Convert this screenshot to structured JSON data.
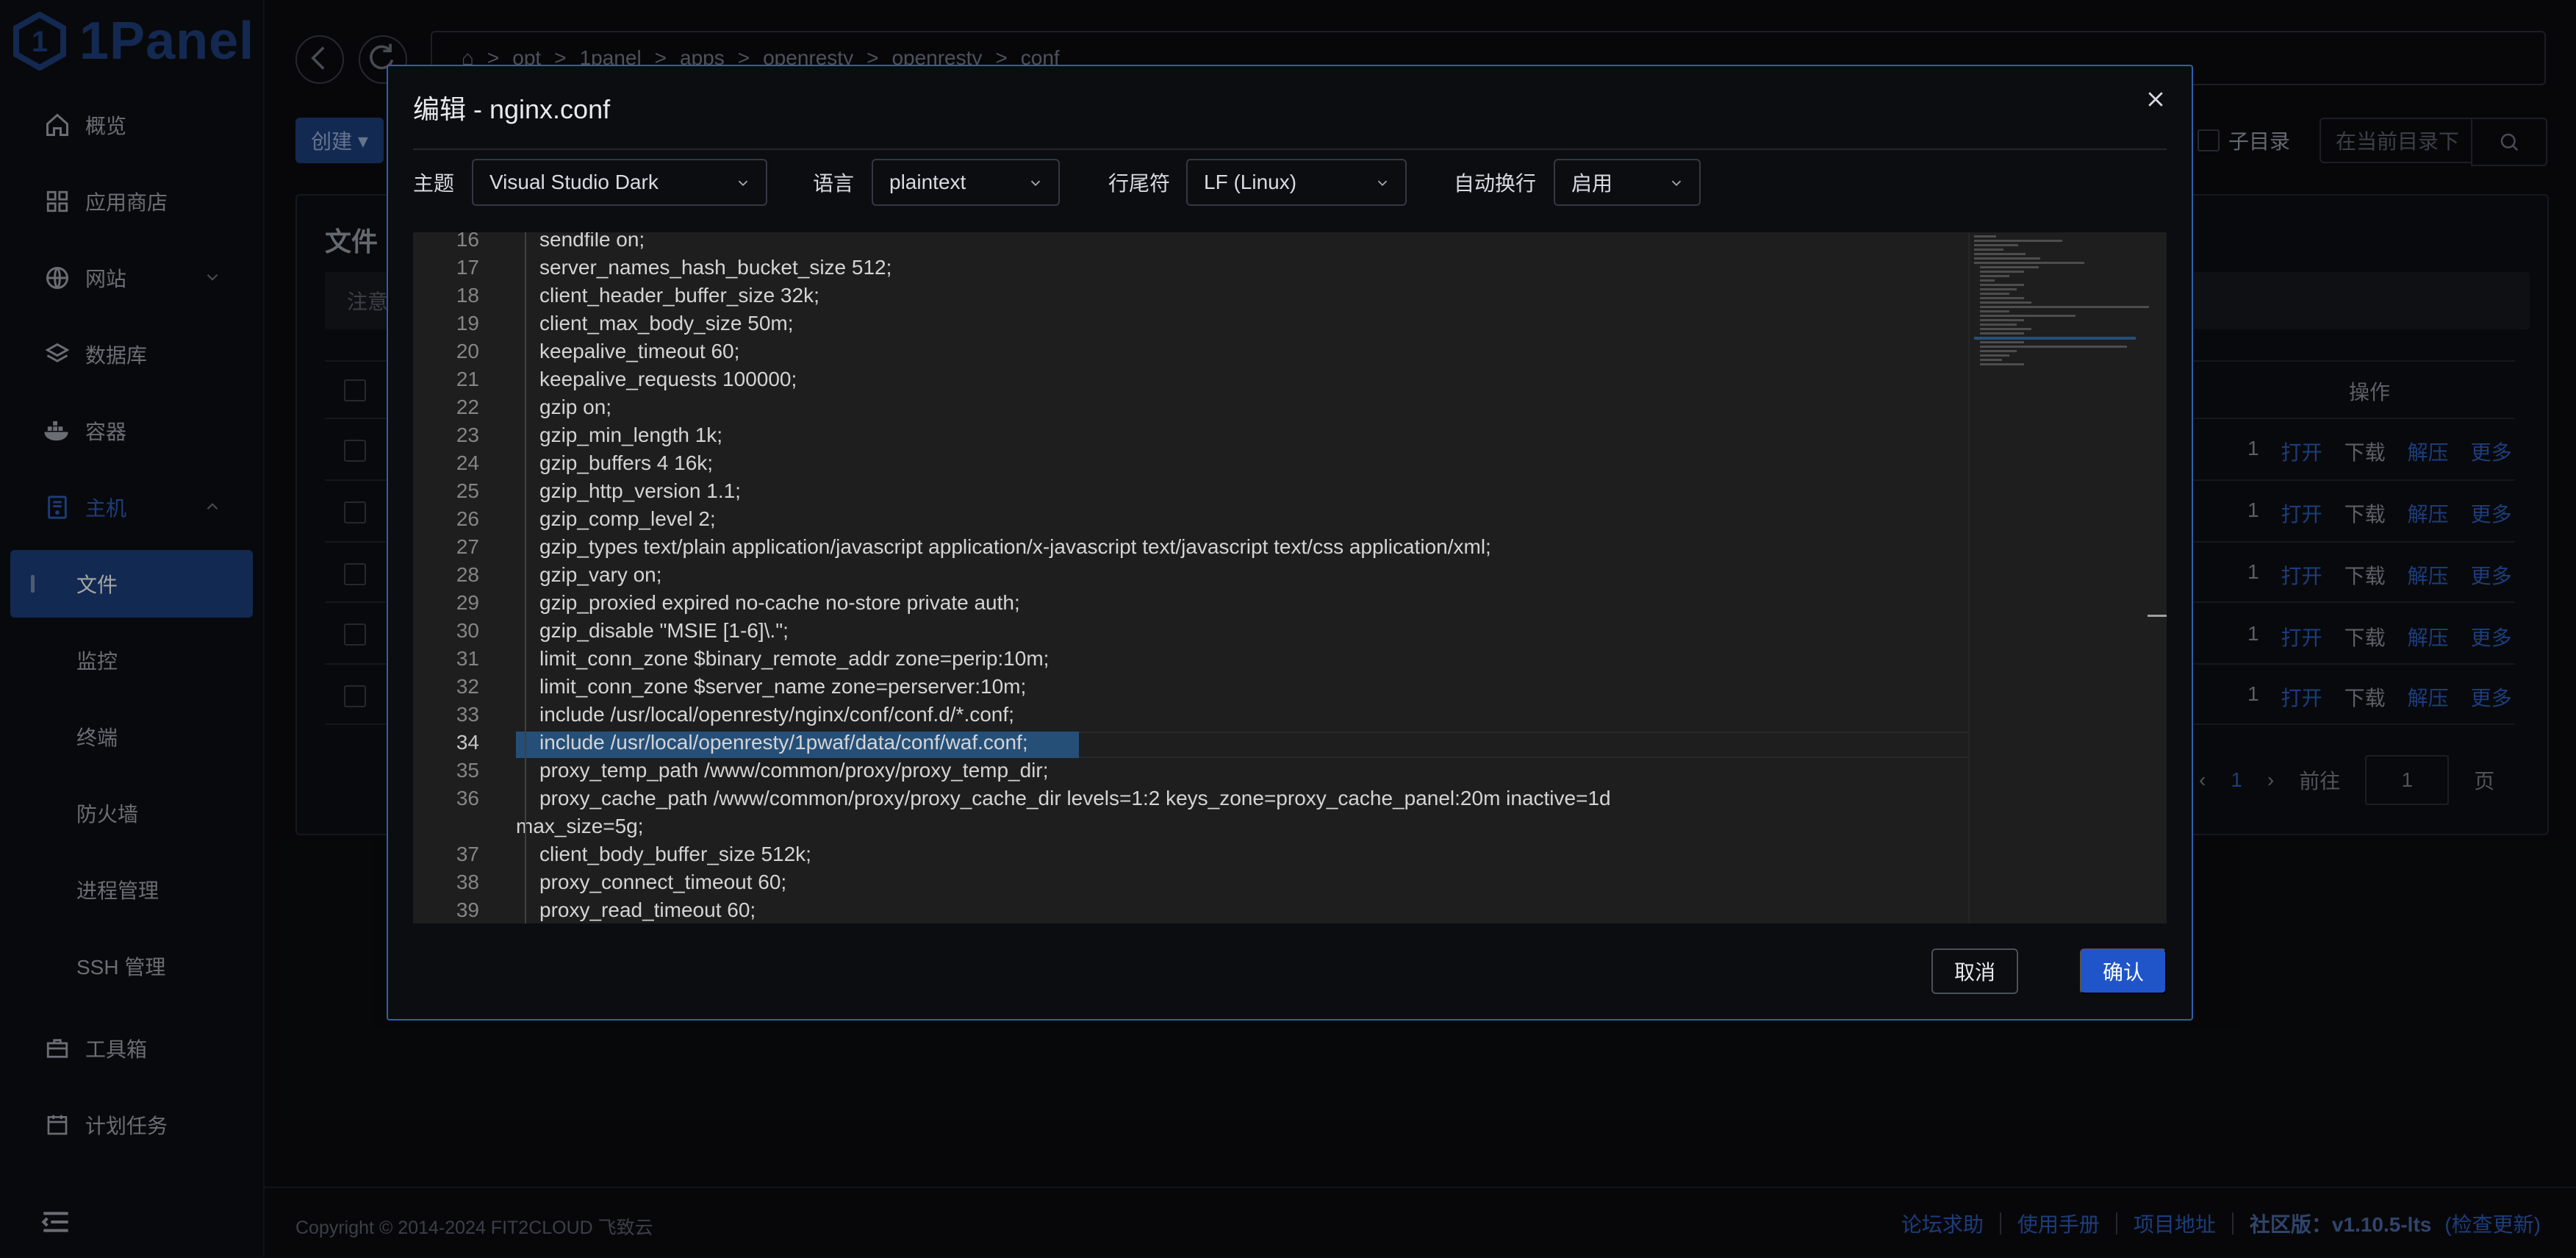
{
  "app": {
    "logo_text": "1Panel"
  },
  "sidebar": {
    "items": [
      {
        "label": "概览",
        "icon": "home-icon"
      },
      {
        "label": "应用商店",
        "icon": "grid-icon"
      },
      {
        "label": "网站",
        "icon": "globe-icon"
      },
      {
        "label": "数据库",
        "icon": "layers-icon"
      },
      {
        "label": "容器",
        "icon": "docker-icon"
      },
      {
        "label": "主机",
        "icon": "server-icon"
      }
    ],
    "host_children": [
      "文件",
      "监控",
      "终端",
      "防火墙",
      "进程管理",
      "SSH 管理"
    ],
    "bottom_items": [
      {
        "label": "工具箱",
        "icon": "toolbox-icon"
      },
      {
        "label": "计划任务",
        "icon": "calendar-icon"
      }
    ]
  },
  "background": {
    "path": [
      "opt",
      "1panel",
      "apps",
      "openresty",
      "openresty",
      "conf"
    ],
    "create_label": "创建",
    "panel_title": "文件",
    "note_text": "注意",
    "subdir_label": "子目录",
    "search_placeholder": "在当前目录下",
    "ops_header": "操作",
    "row_ops": [
      "打开",
      "下载",
      "解压",
      "更多"
    ],
    "row_count": 5,
    "row_partial_text": "1",
    "pager": {
      "current": "1",
      "goto_label": "前往",
      "goto_value": "1",
      "page_label": "页"
    }
  },
  "footer": {
    "copyright": "Copyright © 2014-2024 FIT2CLOUD 飞致云",
    "links": [
      "论坛求助",
      "使用手册",
      "项目地址"
    ],
    "version": "社区版：v1.10.5-lts",
    "check_update": "(检查更新)"
  },
  "modal": {
    "title": "编辑 - nginx.conf",
    "theme_label": "主题",
    "theme_value": "Visual Studio Dark",
    "language_label": "语言",
    "language_value": "plaintext",
    "eol_label": "行尾符",
    "eol_value": "LF (Linux)",
    "wrap_label": "自动换行",
    "wrap_value": "启用",
    "cancel_label": "取消",
    "confirm_label": "确认",
    "editor": {
      "lines": [
        {
          "n": "16",
          "text": "sendfile on;"
        },
        {
          "n": "17",
          "text": "server_names_hash_bucket_size 512;"
        },
        {
          "n": "18",
          "text": "client_header_buffer_size 32k;"
        },
        {
          "n": "19",
          "text": "client_max_body_size 50m;"
        },
        {
          "n": "20",
          "text": "keepalive_timeout 60;"
        },
        {
          "n": "21",
          "text": "keepalive_requests 100000;"
        },
        {
          "n": "22",
          "text": "gzip on;"
        },
        {
          "n": "23",
          "text": "gzip_min_length 1k;"
        },
        {
          "n": "24",
          "text": "gzip_buffers 4 16k;"
        },
        {
          "n": "25",
          "text": "gzip_http_version 1.1;"
        },
        {
          "n": "26",
          "text": "gzip_comp_level 2;"
        },
        {
          "n": "27",
          "text": "gzip_types text/plain application/javascript application/x-javascript text/javascript text/css application/xml;"
        },
        {
          "n": "28",
          "text": "gzip_vary on;"
        },
        {
          "n": "29",
          "text": "gzip_proxied expired no-cache no-store private auth;"
        },
        {
          "n": "30",
          "text": "gzip_disable \"MSIE [1-6]\\.\";"
        },
        {
          "n": "31",
          "text": "limit_conn_zone $binary_remote_addr zone=perip:10m;"
        },
        {
          "n": "32",
          "text": "limit_conn_zone $server_name zone=perserver:10m;"
        },
        {
          "n": "33",
          "text": "include /usr/local/openresty/nginx/conf/conf.d/*.conf;"
        },
        {
          "n": "34",
          "text": "include /usr/local/openresty/1pwaf/data/conf/waf.conf;",
          "selected": true
        },
        {
          "n": "35",
          "text": "proxy_temp_path /www/common/proxy/proxy_temp_dir;"
        },
        {
          "n": "36",
          "text": "proxy_cache_path /www/common/proxy/proxy_cache_dir levels=1:2 keys_zone=proxy_cache_panel:20m inactive=1d",
          "wrap": "max_size=5g;"
        },
        {
          "n": "37",
          "text": "client_body_buffer_size 512k;"
        },
        {
          "n": "38",
          "text": "proxy_connect_timeout 60;"
        },
        {
          "n": "39",
          "text": "proxy_read_timeout 60;"
        }
      ]
    }
  }
}
